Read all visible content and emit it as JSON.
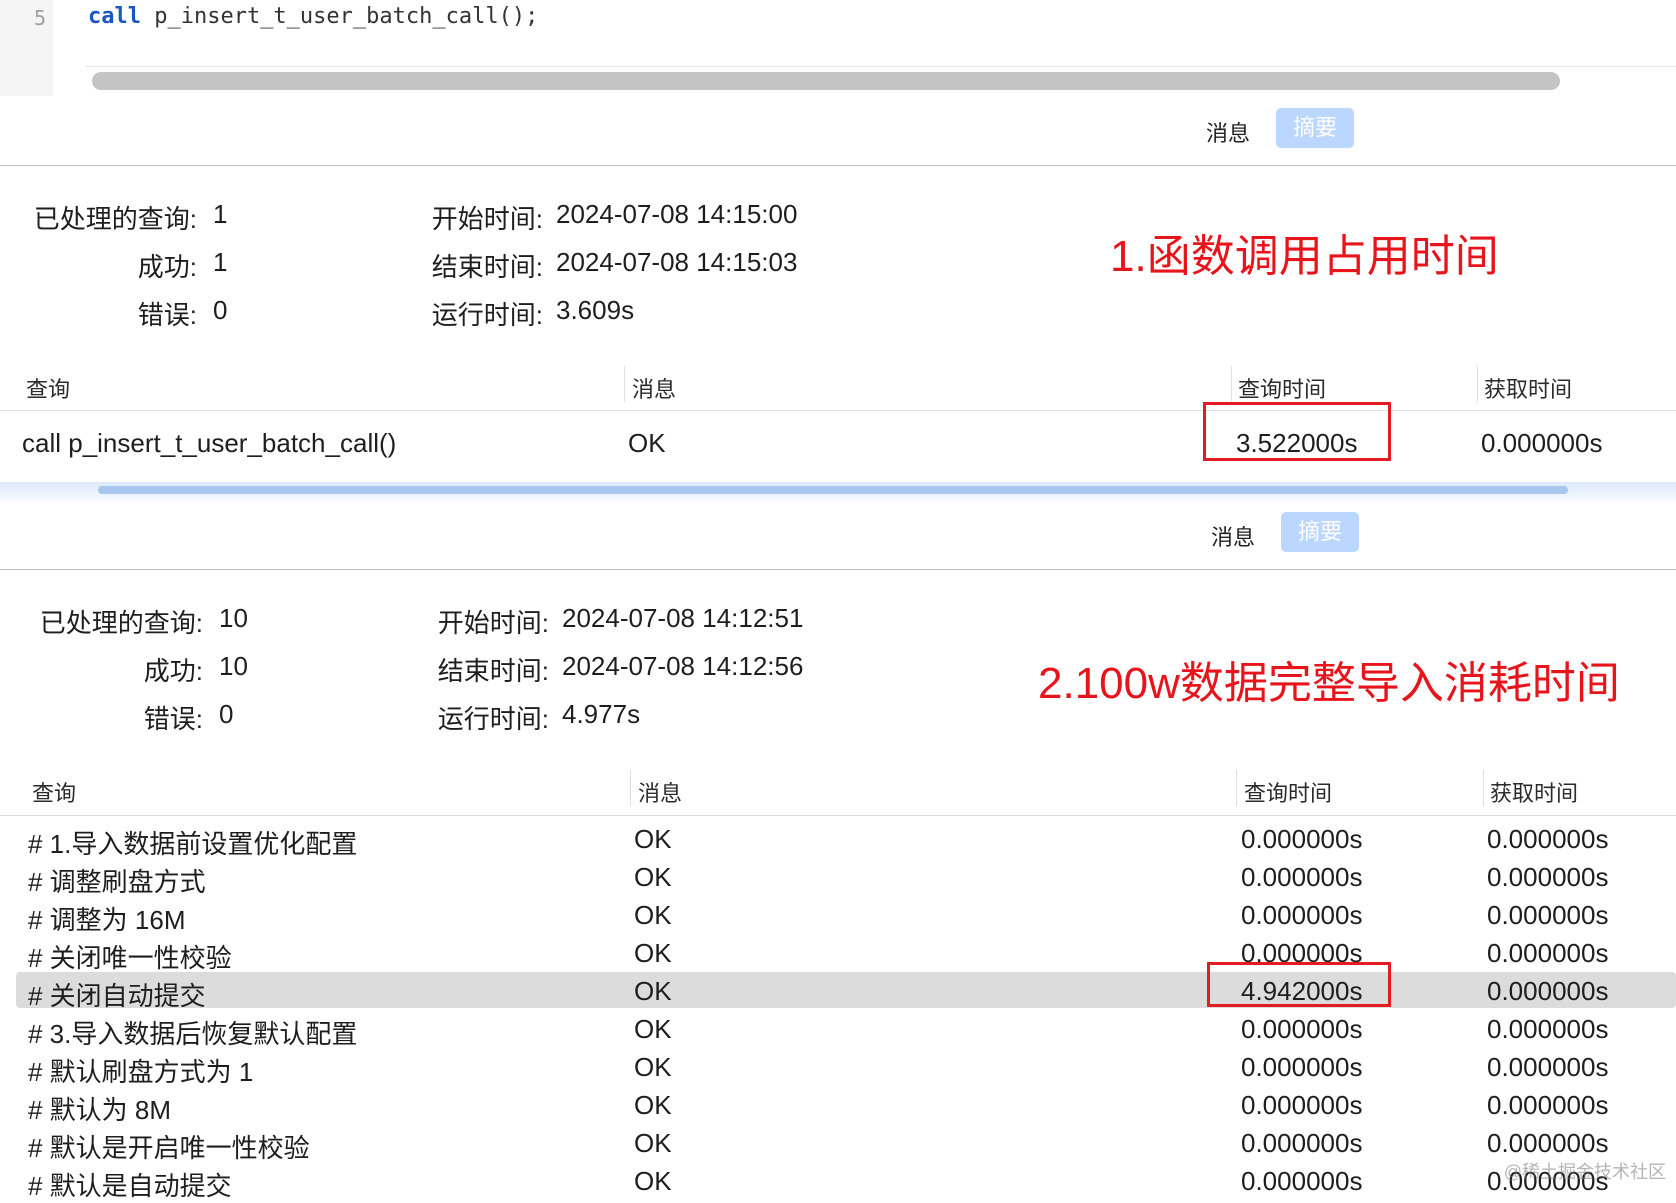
{
  "editor": {
    "line_number": "5",
    "code_keyword": "call",
    "code_rest": " p_insert_t_user_batch_call();"
  },
  "panel1": {
    "tabs": {
      "message": "消息",
      "summary": "摘要"
    },
    "summary": {
      "processed_label": "已处理的查询:",
      "processed_value": "1",
      "success_label": "成功:",
      "success_value": "1",
      "errors_label": "错误:",
      "errors_value": "0",
      "start_label": "开始时间:",
      "start_value": "2024-07-08 14:15:00",
      "end_label": "结束时间:",
      "end_value": "2024-07-08 14:15:03",
      "run_label": "运行时间:",
      "run_value": "3.609s"
    },
    "annotation": "1.函数调用占用时间",
    "columns": {
      "query": "查询",
      "message": "消息",
      "query_time": "查询时间",
      "fetch_time": "获取时间"
    },
    "rows": [
      {
        "query": "call p_insert_t_user_batch_call()",
        "message": "OK",
        "query_time": "3.522000s",
        "fetch_time": "0.000000s"
      }
    ]
  },
  "panel2": {
    "tabs": {
      "message": "消息",
      "summary": "摘要"
    },
    "summary": {
      "processed_label": "已处理的查询:",
      "processed_value": "10",
      "success_label": "成功:",
      "success_value": "10",
      "errors_label": "错误:",
      "errors_value": "0",
      "start_label": "开始时间:",
      "start_value": "2024-07-08 14:12:51",
      "end_label": "结束时间:",
      "end_value": "2024-07-08 14:12:56",
      "run_label": "运行时间:",
      "run_value": "4.977s"
    },
    "annotation": "2.100w数据完整导入消耗时间",
    "columns": {
      "query": "查询",
      "message": "消息",
      "query_time": "查询时间",
      "fetch_time": "获取时间"
    },
    "rows": [
      {
        "query": "# 1.导入数据前设置优化配置",
        "message": "OK",
        "query_time": "0.000000s",
        "fetch_time": "0.000000s"
      },
      {
        "query": "# 调整刷盘方式",
        "message": "OK",
        "query_time": "0.000000s",
        "fetch_time": "0.000000s"
      },
      {
        "query": "# 调整为 16M",
        "message": "OK",
        "query_time": "0.000000s",
        "fetch_time": "0.000000s"
      },
      {
        "query": "# 关闭唯一性校验",
        "message": "OK",
        "query_time": "0.000000s",
        "fetch_time": "0.000000s"
      },
      {
        "query": "# 关闭自动提交",
        "message": "OK",
        "query_time": "4.942000s",
        "fetch_time": "0.000000s"
      },
      {
        "query": "# 3.导入数据后恢复默认配置",
        "message": "OK",
        "query_time": "0.000000s",
        "fetch_time": "0.000000s"
      },
      {
        "query": "# 默认刷盘方式为 1",
        "message": "OK",
        "query_time": "0.000000s",
        "fetch_time": "0.000000s"
      },
      {
        "query": "# 默认为 8M",
        "message": "OK",
        "query_time": "0.000000s",
        "fetch_time": "0.000000s"
      },
      {
        "query": "# 默认是开启唯一性校验",
        "message": "OK",
        "query_time": "0.000000s",
        "fetch_time": "0.000000s"
      },
      {
        "query": "# 默认是自动提交",
        "message": "OK",
        "query_time": "0.000000s",
        "fetch_time": "0.000000s"
      }
    ],
    "selected_row": 4
  },
  "watermark": "@稀土掘金技术社区"
}
